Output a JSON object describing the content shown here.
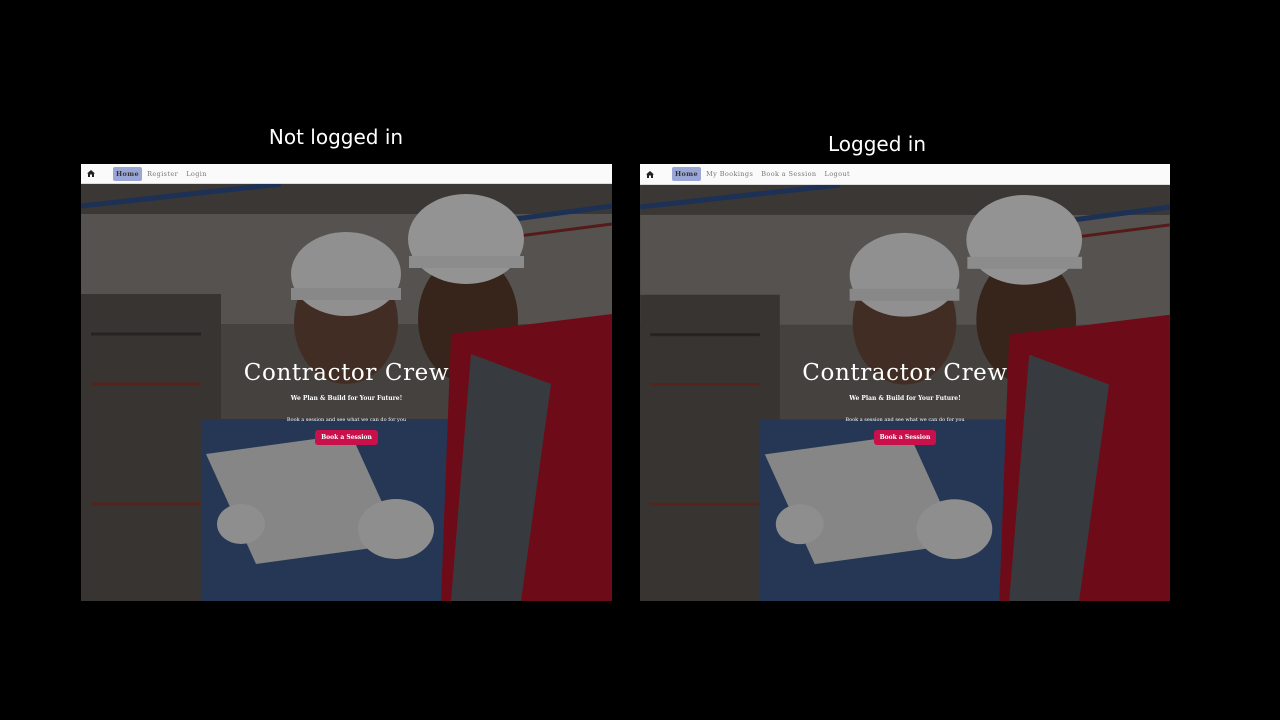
{
  "captions": {
    "left": "Not logged in",
    "right": "Logged in"
  },
  "left_shot": {
    "nav": {
      "home_icon": "home-icon",
      "items": [
        "Home",
        "Register",
        "Login"
      ]
    },
    "hero": {
      "title": "Contractor Crew",
      "subtitle": "We Plan & Build for Your Future!",
      "description": "Book a session and see what we can do for you",
      "button": "Book a Session"
    }
  },
  "right_shot": {
    "nav": {
      "home_icon": "home-icon",
      "items": [
        "Home",
        "My Bookings",
        "Book a Session",
        "Logout"
      ]
    },
    "hero": {
      "title": "Contractor Crew",
      "subtitle": "We Plan & Build for Your Future!",
      "description": "Book a session and see what we can do for you",
      "button": "Book a Session"
    }
  },
  "colors": {
    "button": "#c8104a",
    "active_nav": "#9aa6d6",
    "navbar": "#fafafa"
  }
}
